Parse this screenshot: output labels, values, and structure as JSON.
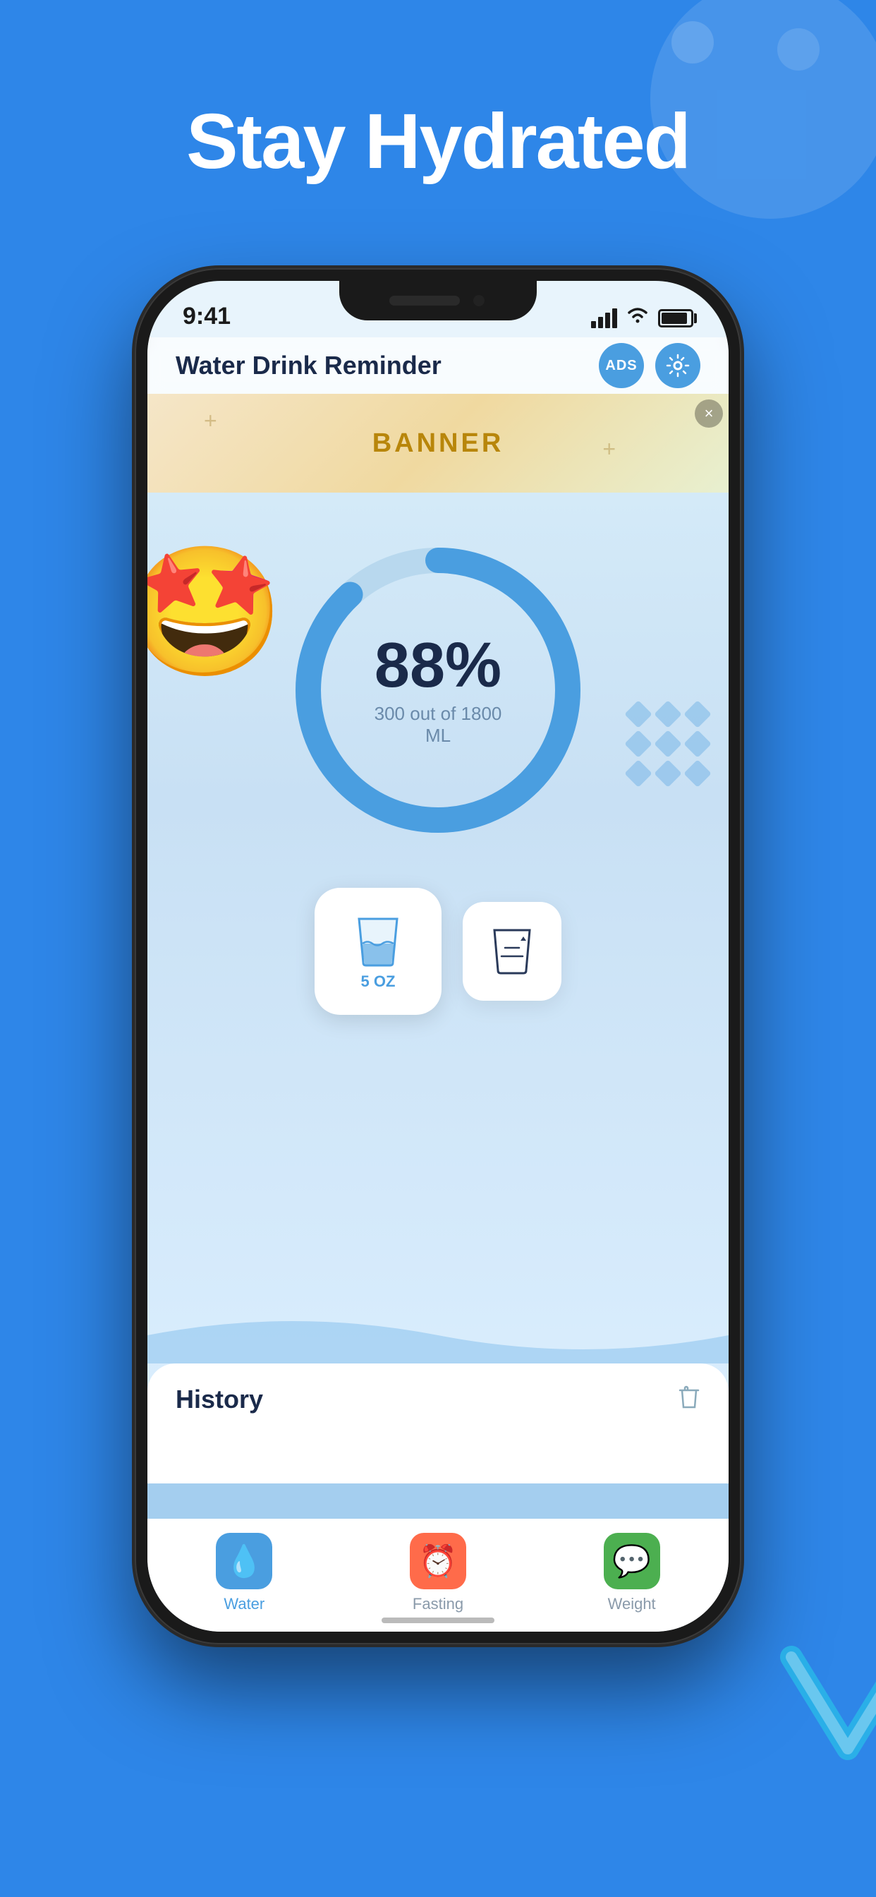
{
  "page": {
    "title": "Stay Hydrated",
    "background_color": "#2E86E8"
  },
  "status_bar": {
    "time": "9:41"
  },
  "app_header": {
    "title": "Water Drink Reminder",
    "ads_label": "ADS"
  },
  "banner": {
    "text": "BANNER",
    "close_label": "×"
  },
  "progress": {
    "percent": "88%",
    "detail": "300 out of 1800 ML",
    "value": 88,
    "current": 300,
    "goal": 1800,
    "unit": "ML"
  },
  "water_button": {
    "amount": "5",
    "unit": "OZ"
  },
  "history": {
    "title": "History"
  },
  "tab_bar": {
    "items": [
      {
        "label": "Water",
        "icon": "💧",
        "active": true
      },
      {
        "label": "Fasting",
        "icon": "⏰",
        "active": false
      },
      {
        "label": "Weight",
        "icon": "💬",
        "active": false
      }
    ]
  },
  "decorative": {
    "emoji": "🤩"
  }
}
